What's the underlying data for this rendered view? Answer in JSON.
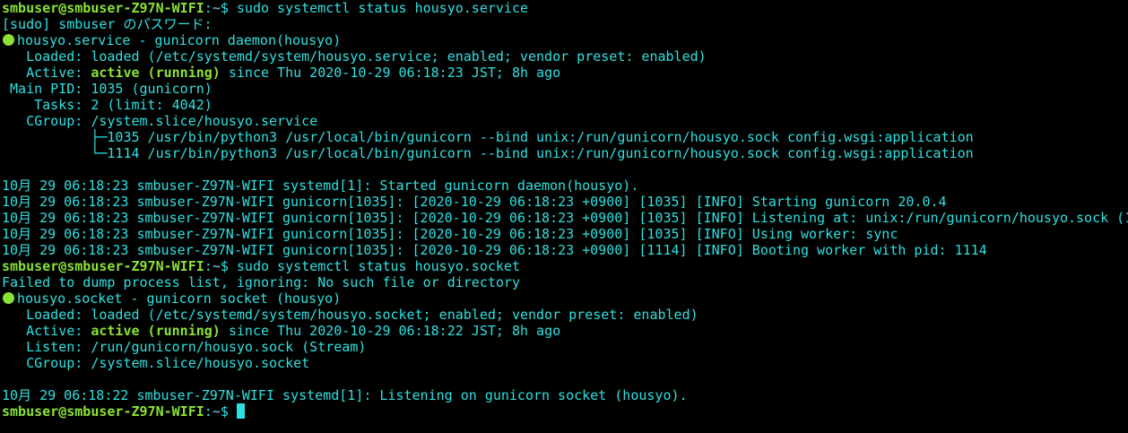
{
  "prompt": {
    "user_host": "smbuser@smbuser-Z97N-WIFI",
    "colon": ":",
    "path": "~",
    "symbol": "$ "
  },
  "commands": {
    "cmd1": "sudo systemctl status housyo.service",
    "cmd2": "sudo systemctl status housyo.socket"
  },
  "sudo_prompt": "[sudo] smbuser のパスワード:",
  "service": {
    "title": "housyo.service - gunicorn daemon(housyo)",
    "loaded": "   Loaded: loaded (/etc/systemd/system/housyo.service; enabled; vendor preset: enabled)",
    "active_label": "   Active: ",
    "active_state": "active (running)",
    "active_since": " since Thu 2020-10-29 06:18:23 JST; 8h ago",
    "main_pid": " Main PID: 1035 (gunicorn)",
    "tasks": "    Tasks: 2 (limit: 4042)",
    "cgroup": "   CGroup: /system.slice/housyo.service",
    "tree_1": "           ├─1035 /usr/bin/python3 /usr/local/bin/gunicorn --bind unix:/run/gunicorn/housyo.sock config.wsgi:application",
    "tree_2": "           └─1114 /usr/bin/python3 /usr/local/bin/gunicorn --bind unix:/run/gunicorn/housyo.sock config.wsgi:application"
  },
  "service_logs": [
    "10月 29 06:18:23 smbuser-Z97N-WIFI systemd[1]: Started gunicorn daemon(housyo).",
    "10月 29 06:18:23 smbuser-Z97N-WIFI gunicorn[1035]: [2020-10-29 06:18:23 +0900] [1035] [INFO] Starting gunicorn 20.0.4",
    "10月 29 06:18:23 smbuser-Z97N-WIFI gunicorn[1035]: [2020-10-29 06:18:23 +0900] [1035] [INFO] Listening at: unix:/run/gunicorn/housyo.sock (1",
    "10月 29 06:18:23 smbuser-Z97N-WIFI gunicorn[1035]: [2020-10-29 06:18:23 +0900] [1035] [INFO] Using worker: sync",
    "10月 29 06:18:23 smbuser-Z97N-WIFI gunicorn[1035]: [2020-10-29 06:18:23 +0900] [1114] [INFO] Booting worker with pid: 1114"
  ],
  "socket_warning": "Failed to dump process list, ignoring: No such file or directory",
  "socket": {
    "title": "housyo.socket - gunicorn socket (housyo)",
    "loaded": "   Loaded: loaded (/etc/systemd/system/housyo.socket; enabled; vendor preset: enabled)",
    "active_label": "   Active: ",
    "active_state": "active (running)",
    "active_since": " since Thu 2020-10-29 06:18:22 JST; 8h ago",
    "listen": "   Listen: /run/gunicorn/housyo.sock (Stream)",
    "cgroup": "   CGroup: /system.slice/housyo.socket"
  },
  "socket_logs": [
    "10月 29 06:18:22 smbuser-Z97N-WIFI systemd[1]: Listening on gunicorn socket (housyo)."
  ],
  "colors": {
    "background": "#000000",
    "text": "#2fe0e0",
    "prompt_user": "#8ae234",
    "prompt_path": "#729fcf",
    "status_dot": "#8ae234"
  },
  "icons": {
    "status": "green-status-dot-icon",
    "cursor": "block-cursor"
  }
}
